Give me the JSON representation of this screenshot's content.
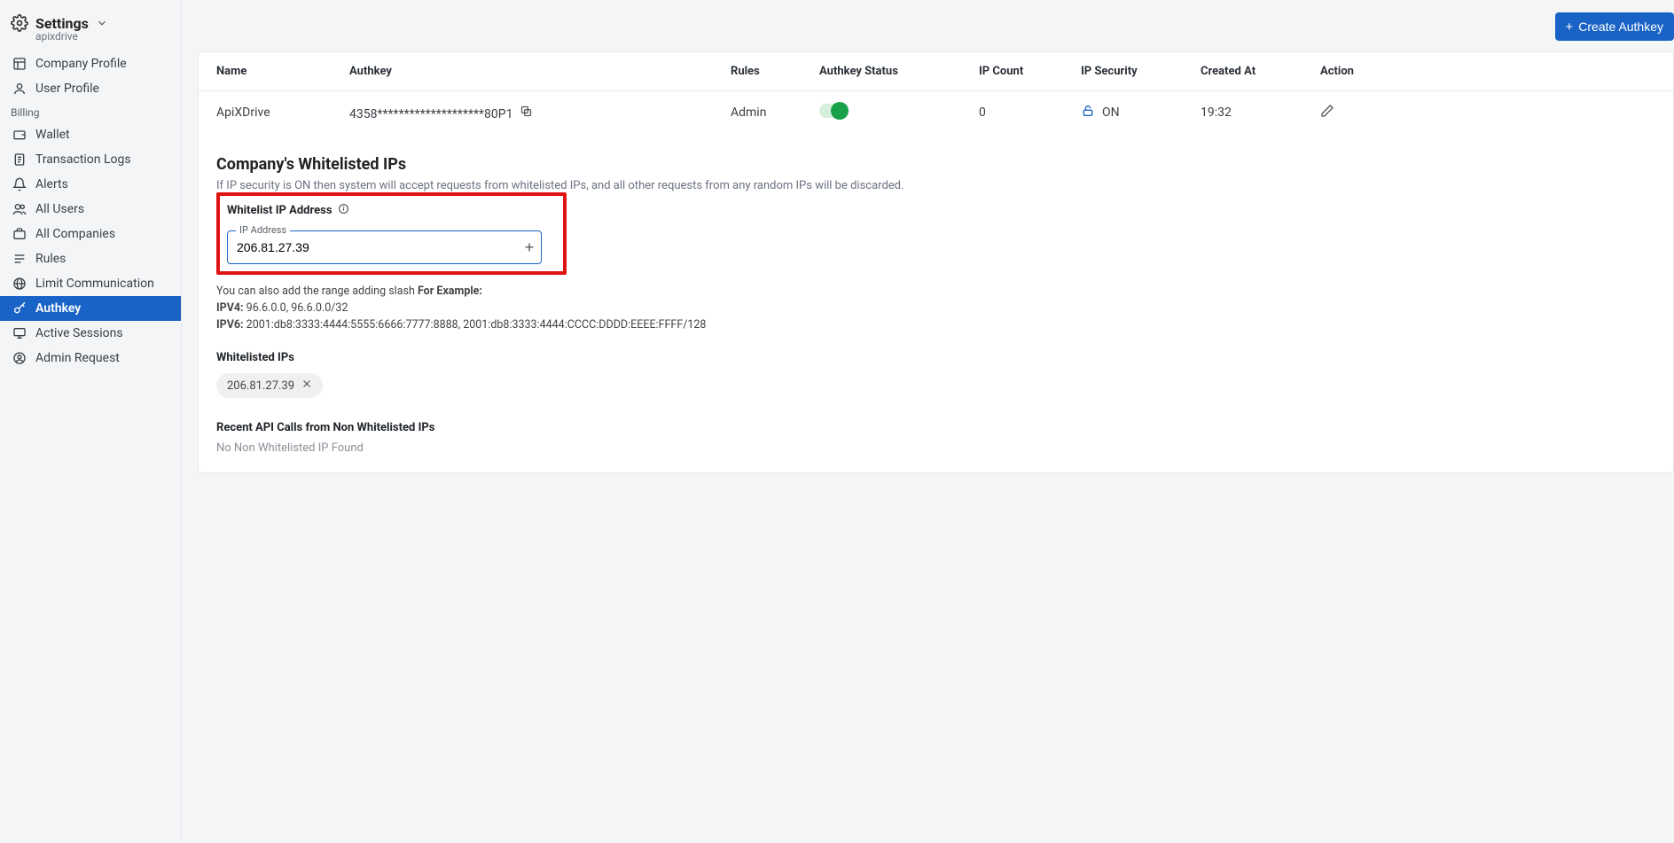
{
  "sidebar": {
    "title": "Settings",
    "subtitle": "apixdrive",
    "top_items": [
      {
        "label": "Company Profile",
        "icon": "layout"
      },
      {
        "label": "User Profile",
        "icon": "user"
      }
    ],
    "section_label": "Billing",
    "items": [
      {
        "label": "Wallet",
        "icon": "wallet"
      },
      {
        "label": "Transaction Logs",
        "icon": "logs"
      },
      {
        "label": "Alerts",
        "icon": "bell"
      },
      {
        "label": "All Users",
        "icon": "users"
      },
      {
        "label": "All Companies",
        "icon": "briefcase"
      },
      {
        "label": "Rules",
        "icon": "rules"
      },
      {
        "label": "Limit Communication",
        "icon": "globe"
      },
      {
        "label": "Authkey",
        "icon": "key",
        "active": true
      },
      {
        "label": "Active Sessions",
        "icon": "sessions"
      },
      {
        "label": "Admin Request",
        "icon": "admin"
      }
    ]
  },
  "topbar": {
    "create_btn": "Create Authkey"
  },
  "table": {
    "headers": {
      "name": "Name",
      "authkey": "Authkey",
      "rules": "Rules",
      "status": "Authkey Status",
      "ipcount": "IP Count",
      "ipsec": "IP Security",
      "created": "Created At",
      "action": "Action"
    },
    "row": {
      "name": "ApiXDrive",
      "authkey": "4358********************80P1",
      "rules": "Admin",
      "status_on": true,
      "ipcount": "0",
      "ipsec": "ON",
      "created": "19:32"
    }
  },
  "whitelist": {
    "heading": "Company's Whitelisted IPs",
    "desc": "If IP security is ON then system will accept requests from whitelisted IPs, and all other requests from any random IPs will be discarded.",
    "field_label": "Whitelist IP Address",
    "float_label": "IP Address",
    "value": "206.81.27.39",
    "hint_pre": "You can also add the range adding slash ",
    "hint_for": "For Example:",
    "hint_ipv4_label": "IPV4:",
    "hint_ipv4": " 96.6.0.0, 96.6.0.0/32",
    "hint_ipv6_label": "IPV6:",
    "hint_ipv6": " 2001:db8:3333:4444:5555:6666:7777:8888, 2001:db8:3333:4444:CCCC:DDDD:EEEE:FFFF/128",
    "wl_heading": "Whitelisted IPs",
    "chips": [
      "206.81.27.39"
    ],
    "recent_heading": "Recent API Calls from Non Whitelisted IPs",
    "none_found": "No Non Whitelisted IP Found"
  }
}
